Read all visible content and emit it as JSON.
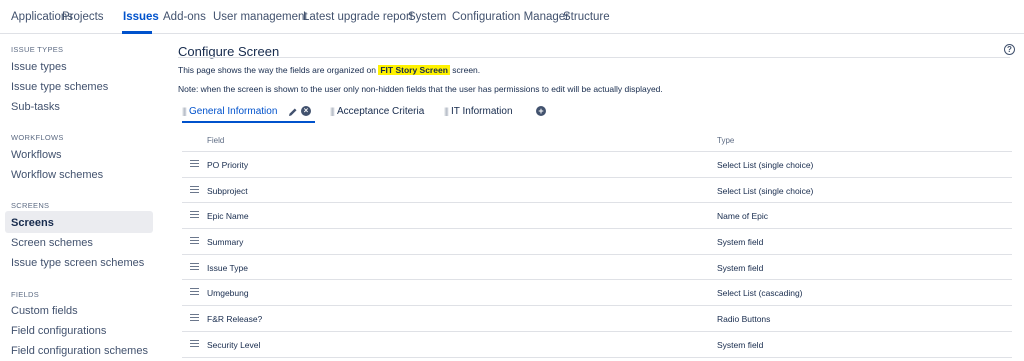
{
  "topnav": {
    "tabs": [
      {
        "label": "Applications"
      },
      {
        "label": "Projects"
      },
      {
        "label": "Issues"
      },
      {
        "label": "Add-ons"
      },
      {
        "label": "User management"
      },
      {
        "label": "Latest upgrade report"
      },
      {
        "label": "System"
      },
      {
        "label": "Configuration Manager"
      },
      {
        "label": "Structure"
      }
    ],
    "active": "Issues"
  },
  "sidebar": {
    "sections": [
      {
        "heading": "ISSUE TYPES",
        "items": [
          "Issue types",
          "Issue type schemes",
          "Sub-tasks"
        ]
      },
      {
        "heading": "WORKFLOWS",
        "items": [
          "Workflows",
          "Workflow schemes"
        ]
      },
      {
        "heading": "SCREENS",
        "items": [
          "Screens",
          "Screen schemes",
          "Issue type screen schemes"
        ]
      },
      {
        "heading": "FIELDS",
        "items": [
          "Custom fields",
          "Field configurations",
          "Field configuration schemes"
        ]
      }
    ],
    "active_item": "Screens"
  },
  "main": {
    "title": "Configure Screen",
    "help_icon": "question-circle-icon",
    "desc_before": "This page shows the way the fields are organized on ",
    "screen_name": "FIT Story Screen",
    "desc_after": " screen.",
    "note": "Note: when the screen is shown to the user only non-hidden fields that the user has permissions to edit will be actually displayed.",
    "tabs": [
      {
        "label": "General Information"
      },
      {
        "label": "Acceptance Criteria"
      },
      {
        "label": "IT Information"
      }
    ],
    "table": {
      "headers": {
        "field": "Field",
        "type": "Type"
      },
      "rows": [
        {
          "field": "PO Priority",
          "type": "Select List (single choice)"
        },
        {
          "field": "Subproject",
          "type": "Select List (single choice)"
        },
        {
          "field": "Epic Name",
          "type": "Name of Epic"
        },
        {
          "field": "Summary",
          "type": "System field"
        },
        {
          "field": "Issue Type",
          "type": "System field"
        },
        {
          "field": "Umgebung",
          "type": "Select List (cascading)"
        },
        {
          "field": "F&R Release?",
          "type": "Radio Buttons"
        },
        {
          "field": "Security Level",
          "type": "System field"
        }
      ]
    }
  },
  "colors": {
    "accent": "#0052cc",
    "highlight": "#fff200",
    "text": "#172b4d",
    "muted": "#5e6c84"
  }
}
